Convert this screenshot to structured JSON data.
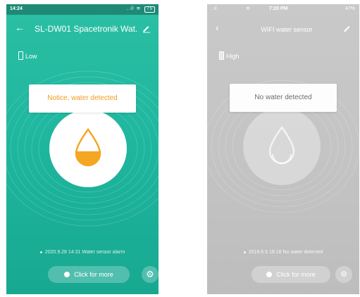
{
  "left_phone": {
    "status": {
      "time": "14:24",
      "icons": "..il",
      "battery": "75"
    },
    "header": {
      "title": "SL-DW01 Spacetronik Wat...",
      "back_icon": "back-arrow-icon",
      "edit_icon": "pencil-icon"
    },
    "battery_level": "Low",
    "notice": "Notice, water detected",
    "log_entry": "2020.9.28 14:31 Water sensor alarm",
    "more_button": "Click for more",
    "settings_icon": "gear-icon",
    "colors": {
      "background": "#1fb79f",
      "notice_text": "#f39a1b",
      "drop": "#f5a623"
    }
  },
  "right_phone": {
    "status": {
      "signal": "..ıl",
      "wifi_icon": "wifi-icon",
      "time": "7:20 PM",
      "battery": "47%"
    },
    "header": {
      "title": "WIFI water sensor",
      "back_icon": "back-arrow-icon",
      "edit_icon": "pencil-icon"
    },
    "battery_level": "High",
    "notice": "No water detected",
    "log_entry": "2018.6.5 18:18 No water detected",
    "more_button": "Click for more",
    "settings_icon": "gear-icon",
    "colors": {
      "background": "#c4c4c4",
      "notice_text": "#6c6c6c"
    }
  }
}
